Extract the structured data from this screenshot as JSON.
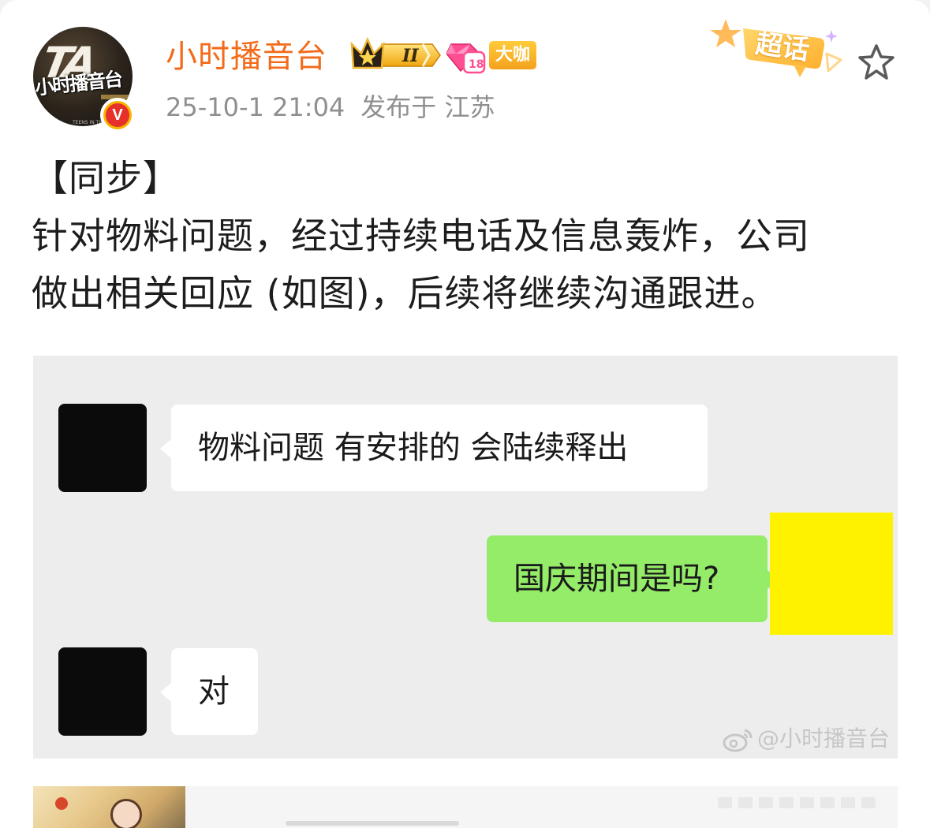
{
  "author": {
    "name": "小时播音台",
    "avatar_text": "TA",
    "avatar_sub": "小时播音台",
    "avatar_caption": "TEENS IN TIMES",
    "verified_badge": "V",
    "level_badge": "II",
    "tag": "大咖"
  },
  "meta": {
    "timestamp": "25-10-1 21:04",
    "location": "发布于 江苏"
  },
  "actions": {
    "chaohua_label": "超话"
  },
  "post": {
    "lines": [
      "【同步】",
      "针对物料问题，经过持续电话及信息轰炸，公司",
      "做出相关回应 (如图)，后续将继续沟通跟进。"
    ]
  },
  "chat": {
    "messages": [
      {
        "side": "left",
        "text": "物料问题 有安排的 会陆续释出"
      },
      {
        "side": "right",
        "text": "国庆期间是吗?"
      },
      {
        "side": "left",
        "text": "对"
      }
    ],
    "watermark": "@小时播音台"
  },
  "colors": {
    "username": "#f26b1a",
    "green_bubble": "#95ec69",
    "redaction_yellow": "#fff200",
    "redaction_black": "#0b0b0b",
    "meta_gray": "#8f8f8f"
  }
}
